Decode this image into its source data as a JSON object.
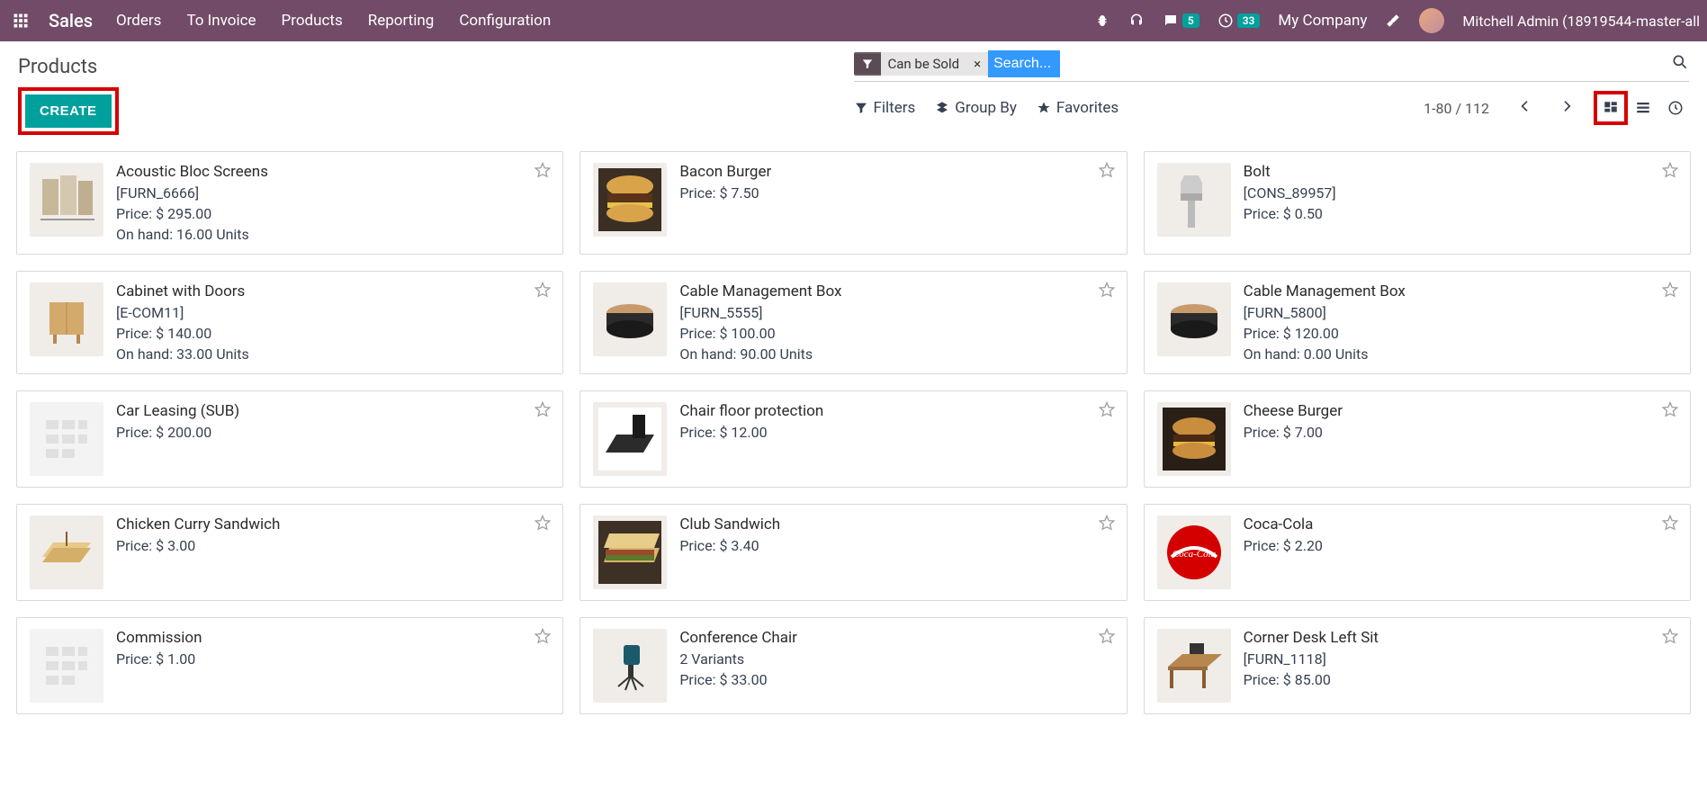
{
  "topbar": {
    "brand": "Sales",
    "nav": [
      "Orders",
      "To Invoice",
      "Products",
      "Reporting",
      "Configuration"
    ],
    "messages_badge": "5",
    "activities_badge": "33",
    "company": "My Company",
    "user": "Mitchell Admin (18919544-master-all"
  },
  "page": {
    "title": "Products",
    "create_label": "CREATE"
  },
  "search": {
    "chip_label": "Can be Sold",
    "placeholder": "Search..."
  },
  "toolbar": {
    "filters": "Filters",
    "group_by": "Group By",
    "favorites": "Favorites",
    "pager": "1-80 / 112"
  },
  "labels": {
    "price": "Price:",
    "onhand": "On hand:",
    "variants_suffix": "Variants"
  },
  "products": [
    {
      "name": "Acoustic Bloc Screens",
      "code": "[FURN_6666]",
      "price": "$ 295.00",
      "onhand": "16.00 Units",
      "thumb": "screens"
    },
    {
      "name": "Bacon Burger",
      "code": "",
      "price": "$ 7.50",
      "onhand": "",
      "thumb": "burger"
    },
    {
      "name": "Bolt",
      "code": "[CONS_89957]",
      "price": "$ 0.50",
      "onhand": "",
      "thumb": "bolt"
    },
    {
      "name": "Cabinet with Doors",
      "code": "[E-COM11]",
      "price": "$ 140.00",
      "onhand": "33.00 Units",
      "thumb": "cabinet"
    },
    {
      "name": "Cable Management Box",
      "code": "[FURN_5555]",
      "price": "$ 100.00",
      "onhand": "90.00 Units",
      "thumb": "cablebox"
    },
    {
      "name": "Cable Management Box",
      "code": "[FURN_5800]",
      "price": "$ 120.00",
      "onhand": "0.00 Units",
      "thumb": "cablebox"
    },
    {
      "name": "Car Leasing (SUB)",
      "code": "",
      "price": "$ 200.00",
      "onhand": "",
      "thumb": "placeholder"
    },
    {
      "name": "Chair floor protection",
      "code": "",
      "price": "$ 12.00",
      "onhand": "",
      "thumb": "mat"
    },
    {
      "name": "Cheese Burger",
      "code": "",
      "price": "$ 7.00",
      "onhand": "",
      "thumb": "cheeseburger"
    },
    {
      "name": "Chicken Curry Sandwich",
      "code": "",
      "price": "$ 3.00",
      "onhand": "",
      "thumb": "sandwich"
    },
    {
      "name": "Club Sandwich",
      "code": "",
      "price": "$ 3.40",
      "onhand": "",
      "thumb": "club"
    },
    {
      "name": "Coca-Cola",
      "code": "",
      "price": "$ 2.20",
      "onhand": "",
      "thumb": "coke"
    },
    {
      "name": "Commission",
      "code": "",
      "price": "$ 1.00",
      "onhand": "",
      "thumb": "placeholder"
    },
    {
      "name": "Conference Chair",
      "code": "",
      "price": "$ 33.00",
      "onhand": "",
      "variants": "2",
      "thumb": "chair"
    },
    {
      "name": "Corner Desk Left Sit",
      "code": "[FURN_1118]",
      "price": "$ 85.00",
      "onhand": "",
      "thumb": "desk"
    }
  ]
}
